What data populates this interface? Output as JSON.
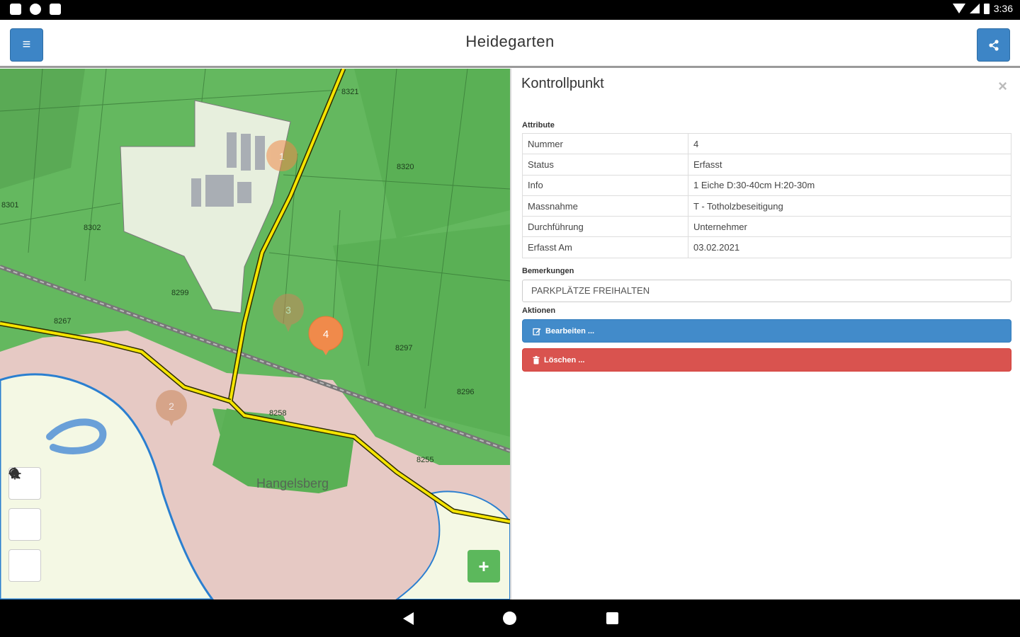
{
  "status_bar": {
    "time": "3:36",
    "icons": [
      "notification-icon",
      "settings-icon",
      "sd-card-icon",
      "wifi-icon",
      "signal-icon",
      "battery-icon"
    ]
  },
  "app_bar": {
    "title": "Heidegarten",
    "menu_icon": "≡",
    "share_icon": "share-icon"
  },
  "map": {
    "markers": [
      {
        "label": "1",
        "state": "faded"
      },
      {
        "label": "3",
        "state": "faded"
      },
      {
        "label": "4",
        "state": "active"
      },
      {
        "label": "2",
        "state": "faded"
      }
    ],
    "parcel_labels": [
      "8321",
      "8320",
      "8302",
      "8299",
      "8297",
      "8296",
      "8258",
      "8255",
      "8267",
      "8301"
    ],
    "place_label": "Hangelsberg",
    "controls": [
      "search-icon",
      "home-icon",
      "locate-icon"
    ],
    "add_icon": "+"
  },
  "panel": {
    "title": "Kontrollpunkt",
    "close_icon": "×",
    "attributes_label": "Attribute",
    "attributes": [
      {
        "key": "Nummer",
        "value": "4"
      },
      {
        "key": "Status",
        "value": "Erfasst"
      },
      {
        "key": "Info",
        "value": "1 Eiche D:30-40cm H:20-30m"
      },
      {
        "key": "Massnahme",
        "value": "T - Totholzbeseitigung"
      },
      {
        "key": "Durchführung",
        "value": "Unternehmer"
      },
      {
        "key": "Erfasst Am",
        "value": "03.02.2021"
      }
    ],
    "remarks_label": "Bemerkungen",
    "remarks_value": "PARKPLÄTZE FREIHALTEN",
    "actions_label": "Aktionen",
    "edit_label": "Bearbeiten ...",
    "delete_label": "Löschen ..."
  },
  "colors": {
    "primary": "#428bca",
    "danger": "#d9534f",
    "success": "#5cb85c",
    "forest": "#64b85f",
    "road": "#f5e400",
    "marker_active": "#f08a4b"
  }
}
